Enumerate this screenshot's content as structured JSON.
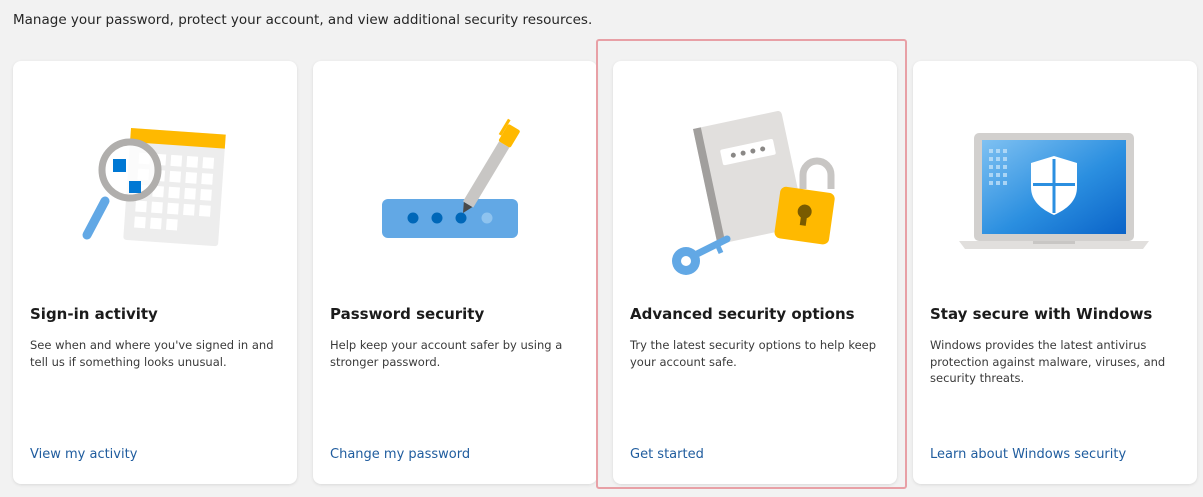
{
  "intro": "Manage your password, protect your account, and view additional security resources.",
  "cards": [
    {
      "icon": "magnifier-calendar-illustration",
      "title": "Sign-in activity",
      "description": "See when and where you've signed in and tell us if something looks unusual.",
      "link": "View my activity"
    },
    {
      "icon": "password-pen-illustration",
      "title": "Password security",
      "description": "Help keep your account safer by using a stronger password.",
      "link": "Change my password"
    },
    {
      "icon": "notebook-key-lock-illustration",
      "title": "Advanced security options",
      "description": "Try the latest security options to help keep your account safe.",
      "link": "Get started"
    },
    {
      "icon": "laptop-shield-illustration",
      "title": "Stay secure with Windows",
      "description": "Windows provides the latest antivirus protection against malware, viruses, and security threats.",
      "link": "Learn about Windows security"
    }
  ],
  "colors": {
    "background": "#f2f2f2",
    "card": "#ffffff",
    "link": "#1f5c9e",
    "highlight": "#e8a0a6",
    "yellow": "#ffb900",
    "blue": "#0078d4",
    "lightBlue": "#62a8e5"
  }
}
